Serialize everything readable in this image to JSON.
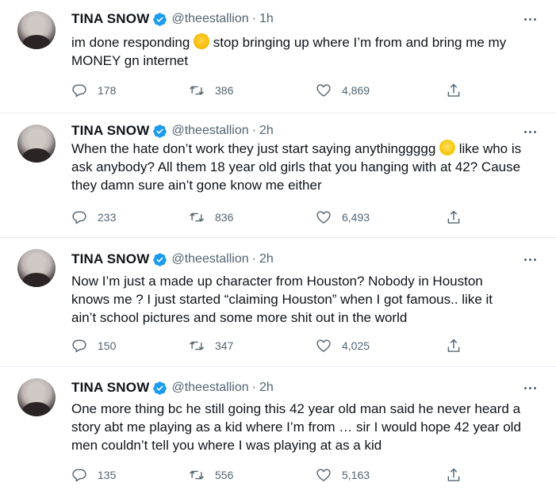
{
  "tweets": [
    {
      "name": "TINA SNOW",
      "handle": "@theestallion",
      "sep": "·",
      "time": "1h",
      "text_a": "im done responding ",
      "emoji": "yawn-emoji",
      "text_b": " stop bringing up where I’m from and bring me my\nMONEY gn internet",
      "replies": "178",
      "retweets": "386",
      "likes": "4,869"
    },
    {
      "name": "TINA SNOW",
      "handle": "@theestallion",
      "sep": "·",
      "time": "2h",
      "text_a": "When the hate don’t work they just start saying anythinggggg ",
      "emoji": "tears-of-joy-emoji",
      "text_b": " like who is\nask anybody? All them 18 year old girls that you hanging with at 42? Cause\nthey damn sure ain’t gone know me either",
      "replies": "233",
      "retweets": "836",
      "likes": "6,493"
    },
    {
      "name": "TINA SNOW",
      "handle": "@theestallion",
      "sep": "·",
      "time": "2h",
      "text_a": "Now I’m just a made up character from Houston? Nobody in Houston\nknows me ? I just started “claiming Houston” when I got famous.. like it\nain’t school pictures and some more shit out in the world",
      "emoji": "",
      "text_b": "",
      "replies": "150",
      "retweets": "347",
      "likes": "4,025"
    },
    {
      "name": "TINA SNOW",
      "handle": "@theestallion",
      "sep": "·",
      "time": "2h",
      "text_a": "One more thing bc he still going this 42 year old man said he never heard a\nstory abt me playing as a kid where I’m from … sir I would hope 42 year old\nmen couldn’t tell you where I was playing at as a kid",
      "emoji": "",
      "text_b": "",
      "replies": "135",
      "retweets": "556",
      "likes": "5,163"
    }
  ],
  "icons": {
    "verified": "verified-badge-icon",
    "more": "more-options-icon",
    "reply": "reply-icon",
    "retweet": "retweet-icon",
    "like": "like-heart-icon",
    "share": "share-icon"
  },
  "colors": {
    "verified": "#1d9bf0",
    "secondary_text": "#536471",
    "divider": "#e6ecf0"
  }
}
